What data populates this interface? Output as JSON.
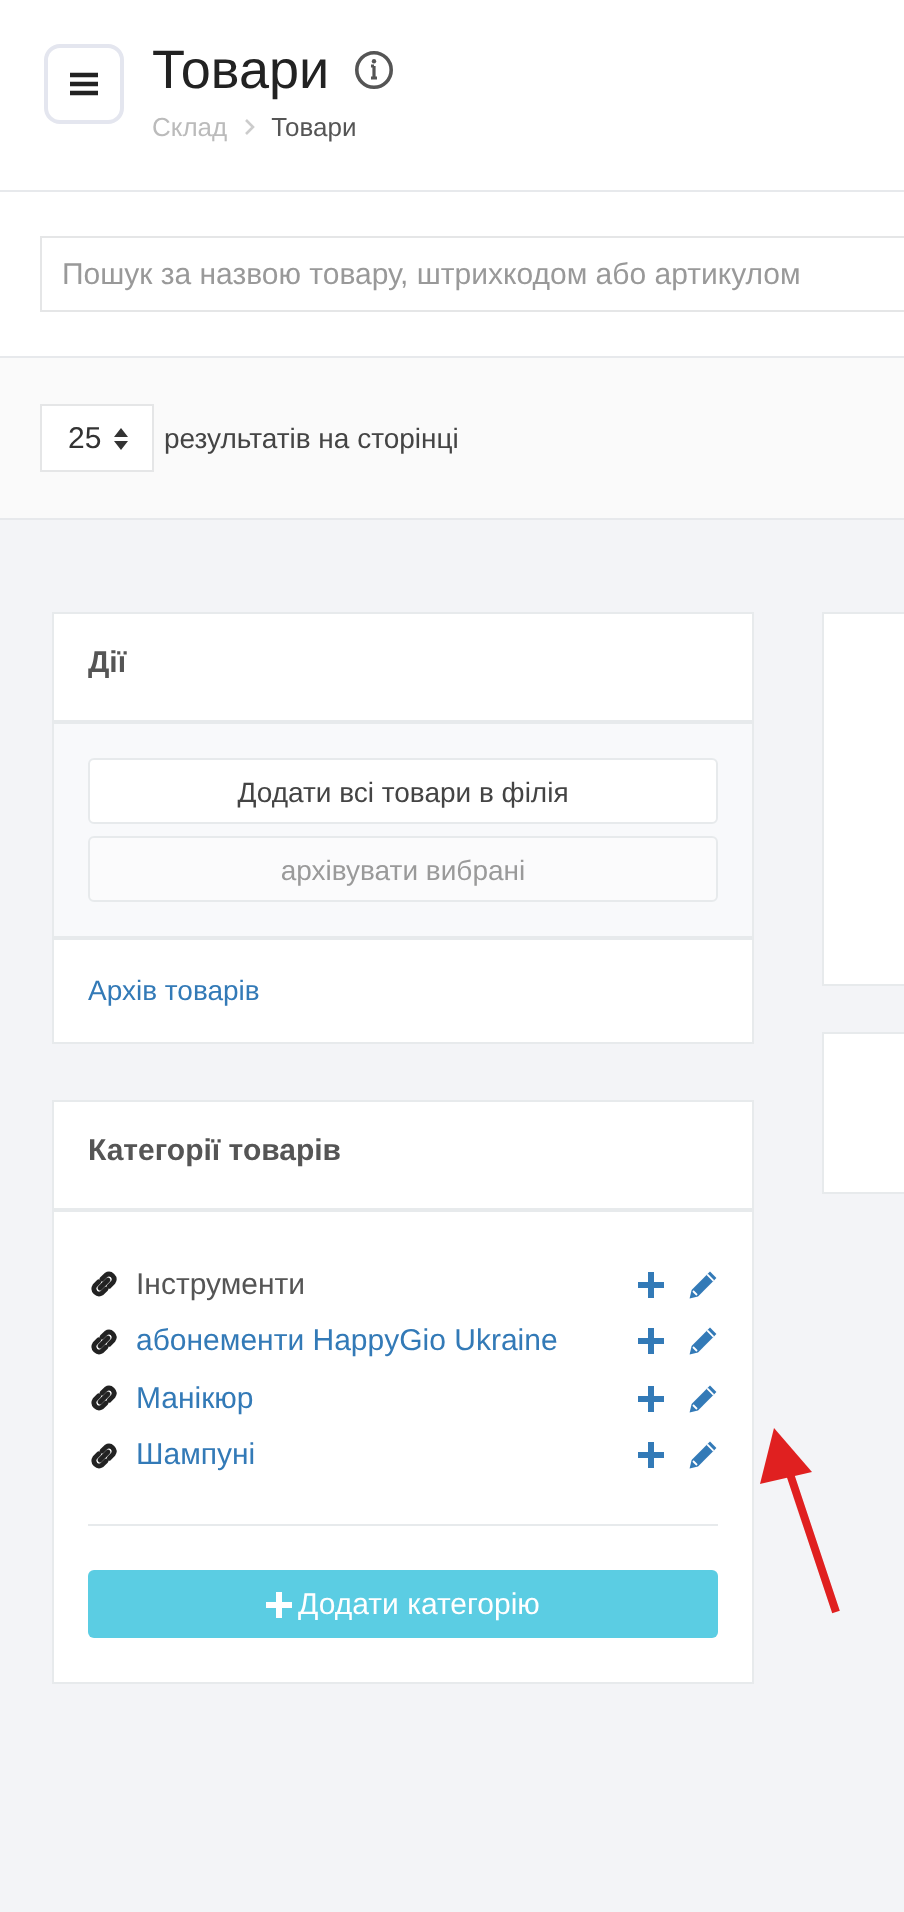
{
  "header": {
    "title": "Товари",
    "breadcrumb": [
      {
        "label": "Склад",
        "current": false
      },
      {
        "label": "Товари",
        "current": true
      }
    ]
  },
  "search": {
    "placeholder": "Пошук за назвою товару, штрихкодом або артикулом"
  },
  "pagination": {
    "per_page": "25",
    "label": "результатів на сторінці"
  },
  "actions": {
    "title": "Дії",
    "buttons": [
      {
        "label": "Додати всі товари в філія",
        "disabled": false
      },
      {
        "label": "архівувати вибрані",
        "disabled": true
      }
    ],
    "link": "Архів товарів"
  },
  "categories": {
    "title": "Категорії товарів",
    "items": [
      {
        "label": "Інструменти",
        "selected": true
      },
      {
        "label": "абонементи HappyGio Ukraine",
        "selected": false
      },
      {
        "label": "Манікюр",
        "selected": false
      },
      {
        "label": "Шампуні",
        "selected": false
      }
    ],
    "add_button": "Додати категорію"
  }
}
